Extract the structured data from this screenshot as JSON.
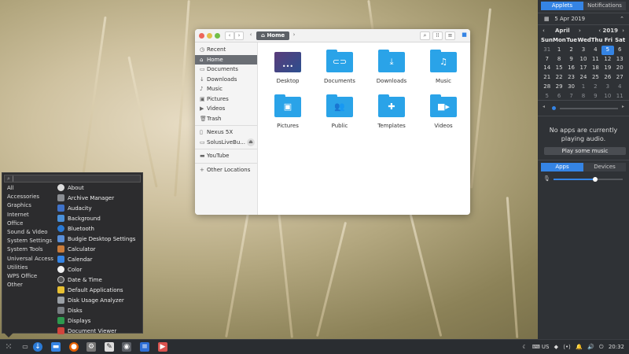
{
  "file_manager": {
    "breadcrumb": "Home",
    "sidebar": [
      "Recent",
      "Home",
      "Documents",
      "Downloads",
      "Music",
      "Pictures",
      "Videos",
      "Trash",
      "Nexus 5X",
      "SolusLiveBu...",
      "YouTube",
      "Other Locations"
    ],
    "folders": [
      "Desktop",
      "Documents",
      "Downloads",
      "Music",
      "Pictures",
      "Public",
      "Templates",
      "Videos"
    ]
  },
  "menu": {
    "categories": [
      "All",
      "Accessories",
      "Graphics",
      "Internet",
      "Office",
      "Sound & Video",
      "System Settings",
      "System Tools",
      "Universal Access",
      "Utilities",
      "WPS Office",
      "Other"
    ],
    "apps": [
      "About",
      "Archive Manager",
      "Audacity",
      "Background",
      "Bluetooth",
      "Budgie Desktop Settings",
      "Calculator",
      "Calendar",
      "Color",
      "Date & Time",
      "Default Applications",
      "Disk Usage Analyzer",
      "Disks",
      "Displays",
      "Document Viewer"
    ]
  },
  "raven": {
    "tab_applets": "Applets",
    "tab_notifications": "Notifications",
    "date": "5 Apr 2019",
    "month": "April",
    "year": "2019",
    "weekdays": [
      "Sun",
      "Mon",
      "Tue",
      "Wed",
      "Thu",
      "Fri",
      "Sat"
    ],
    "weeks": [
      [
        "31",
        "1",
        "2",
        "3",
        "4",
        "5",
        "6"
      ],
      [
        "7",
        "8",
        "9",
        "10",
        "11",
        "12",
        "13"
      ],
      [
        "14",
        "15",
        "16",
        "17",
        "18",
        "19",
        "20"
      ],
      [
        "21",
        "22",
        "23",
        "24",
        "25",
        "26",
        "27"
      ],
      [
        "28",
        "29",
        "30",
        "1",
        "2",
        "3",
        "4"
      ],
      [
        "5",
        "6",
        "7",
        "8",
        "9",
        "10",
        "11"
      ]
    ],
    "no_media_text": "No apps are currently playing audio.",
    "play_button": "Play some music",
    "tab_apps": "Apps",
    "tab_devices": "Devices",
    "volume_level": 0.6
  },
  "taskbar": {
    "keyboard_layout": "US",
    "clock": "20:32"
  }
}
